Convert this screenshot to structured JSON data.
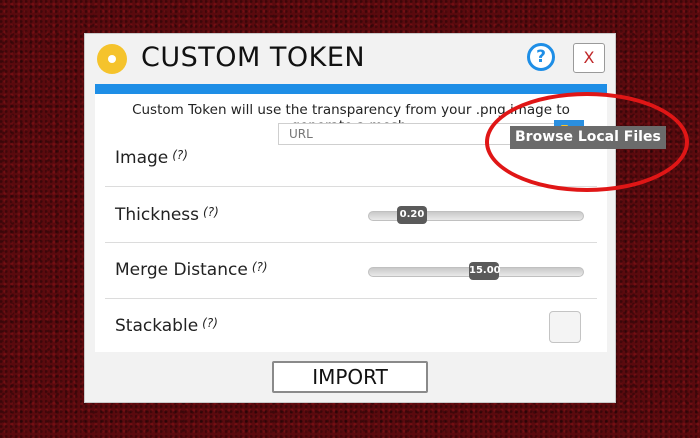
{
  "dialog": {
    "title": "CUSTOM TOKEN",
    "help_label": "?",
    "close_label": "X",
    "description": "Custom Token will use the transparency from your .png image to generate a mesh.",
    "image": {
      "label": "Image",
      "hint": "(?)",
      "url_placeholder": "URL",
      "browse_tooltip": "Browse Local Files"
    },
    "thickness": {
      "label": "Thickness",
      "hint": "(?)",
      "value_label": "0.20",
      "fraction": 0.04
    },
    "merge_distance": {
      "label": "Merge Distance",
      "hint": "(?)",
      "value_label": "15.00",
      "fraction": 0.48
    },
    "stackable": {
      "label": "Stackable",
      "hint": "(?)",
      "checked": false
    },
    "import_label": "IMPORT"
  },
  "colors": {
    "accent": "#1e8ee6",
    "token_icon": "#f5c32c",
    "close": "#c0282a",
    "annotation": "#e01616",
    "background": "#5a0a0e"
  },
  "icons": [
    "token-icon",
    "help-icon",
    "close-icon",
    "folder-icon"
  ]
}
